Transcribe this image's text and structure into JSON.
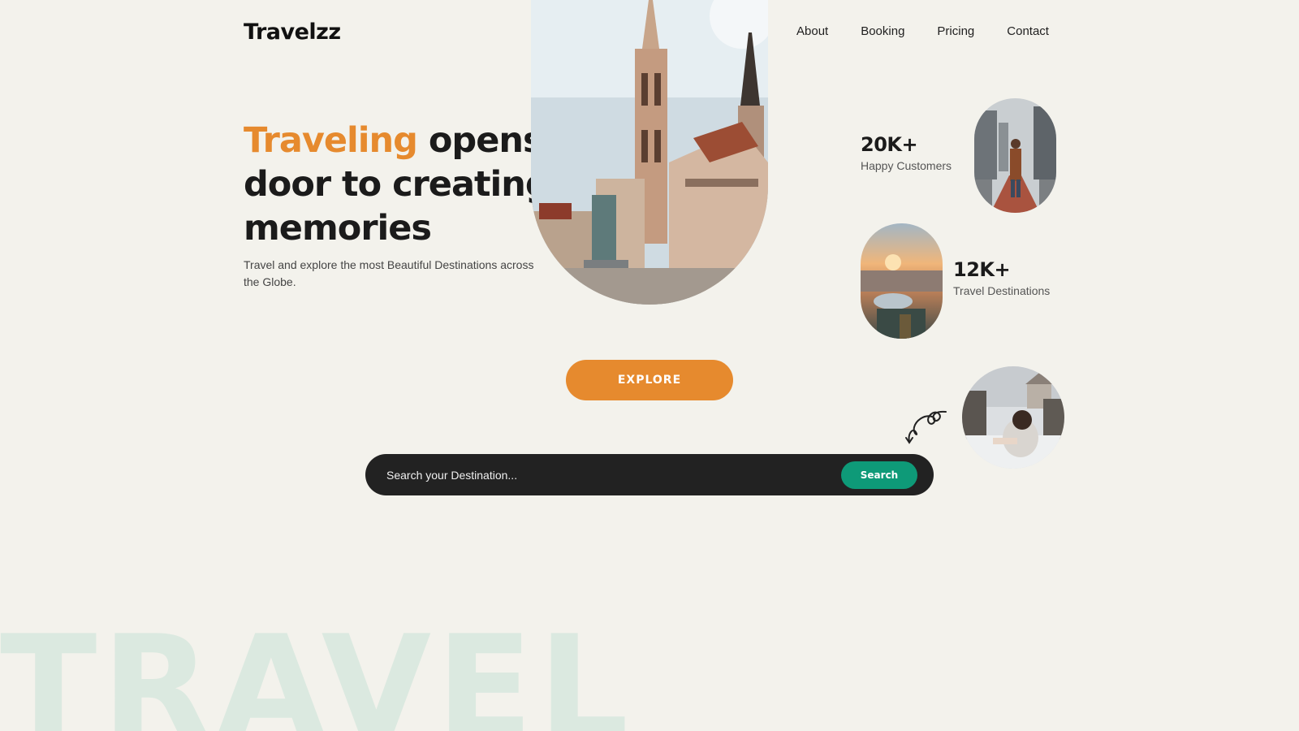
{
  "brand": {
    "logo": "Travelzz"
  },
  "nav": {
    "items": [
      "About",
      "Booking",
      "Pricing",
      "Contact"
    ]
  },
  "hero": {
    "headline_accent": "Traveling",
    "headline_rest": " opens door to creating memories",
    "subtext": "Travel and explore the most Beautiful Destinations across the Globe.",
    "explore_label": "EXPLORE"
  },
  "search": {
    "placeholder": "Search your Destination...",
    "button_label": "Search"
  },
  "stats": [
    {
      "value": "20K+",
      "label": "Happy Customers"
    },
    {
      "value": "12K+",
      "label": "Travel Destinations"
    }
  ],
  "background_word": "TRAVEL",
  "colors": {
    "accent": "#e68a2e",
    "search_button": "#0e9a78",
    "background": "#f3f2ec",
    "search_bar": "#222222",
    "watermark": "#dbe9e0"
  }
}
